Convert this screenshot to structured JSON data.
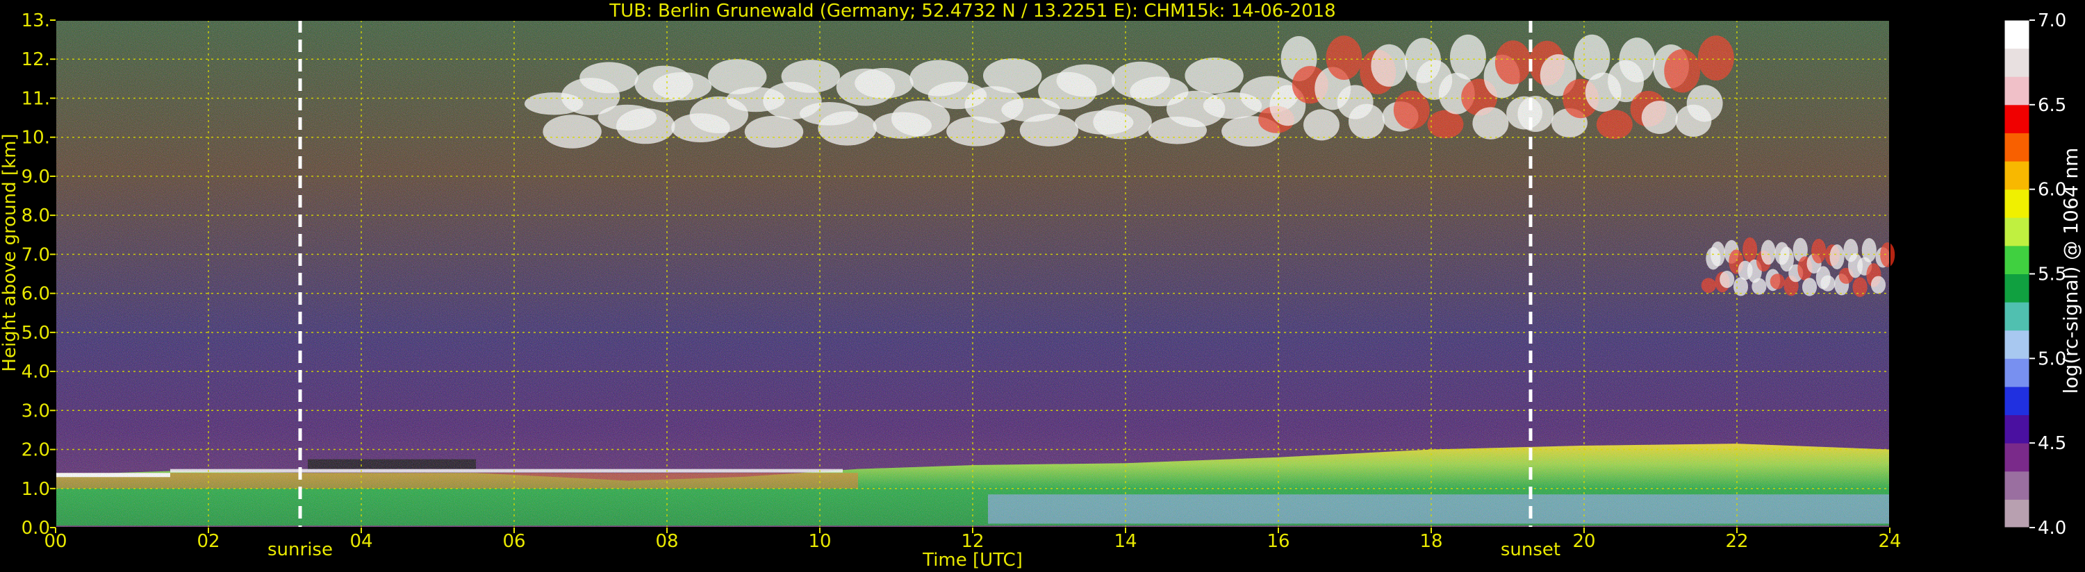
{
  "chart_data": {
    "type": "heatmap",
    "title": "TUB: Berlin Grunewald (Germany; 52.4732 N / 13.2251 E):    CHM15k: 14-06-2018",
    "xlabel": "Time [UTC]",
    "ylabel": "Height above ground [km]",
    "xlim": [
      0,
      24
    ],
    "ylim": [
      0,
      13
    ],
    "x_ticks": [
      "00",
      "02",
      "04",
      "06",
      "08",
      "10",
      "12",
      "14",
      "16",
      "18",
      "20",
      "22",
      "24"
    ],
    "y_ticks": [
      "0.0",
      "1.0",
      "2.0",
      "3.0",
      "4.0",
      "5.0",
      "6.0",
      "7.0",
      "8.0",
      "9.0",
      "10.",
      "11.",
      "12.",
      "13."
    ],
    "grid": true,
    "colorbar": {
      "label": "log(rc-signal) @ 1064 nm",
      "range": [
        4.0,
        7.0
      ],
      "ticks": [
        "4.0",
        "4.5",
        "5.0",
        "5.5",
        "6.0",
        "6.5",
        "7.0"
      ]
    },
    "markers": [
      {
        "label": "sunrise",
        "time": 3.2
      },
      {
        "label": "sunset",
        "time": 19.3
      }
    ],
    "features": {
      "boundary_layer_top_km": [
        {
          "t": 0,
          "h": 1.35
        },
        {
          "t": 1.5,
          "h": 1.45
        },
        {
          "t": 3.2,
          "h": 1.4
        },
        {
          "t": 5.5,
          "h": 1.4
        },
        {
          "t": 6.5,
          "h": 1.3
        },
        {
          "t": 7.5,
          "h": 1.2
        },
        {
          "t": 9,
          "h": 1.3
        },
        {
          "t": 10.5,
          "h": 1.5
        },
        {
          "t": 12,
          "h": 1.6
        },
        {
          "t": 14,
          "h": 1.65
        },
        {
          "t": 16,
          "h": 1.8
        },
        {
          "t": 18,
          "h": 2.0
        },
        {
          "t": 20,
          "h": 2.1
        },
        {
          "t": 22,
          "h": 2.15
        },
        {
          "t": 24,
          "h": 2.0
        }
      ],
      "cirrus_clouds": [
        {
          "t_start": 6.4,
          "t_end": 16.0,
          "h_low": 9.3,
          "h_high": 11.7
        },
        {
          "t_start": 15.9,
          "t_end": 21.8,
          "h_low": 9.3,
          "h_high": 12.2
        },
        {
          "t_start": 21.6,
          "t_end": 24.0,
          "h_low": 5.6,
          "h_high": 7.2
        }
      ]
    }
  },
  "colors": {
    "axis_text": "#e8e800",
    "grid": "#d8d800",
    "marker": "#ffffff",
    "background": "#000000",
    "colorbar_stops": [
      "#b8a0b0",
      "#9a6fa0",
      "#7a2a8a",
      "#4a10a0",
      "#2030e0",
      "#7890f0",
      "#a8c8f0",
      "#50c0b0",
      "#10a040",
      "#40d040",
      "#c0f040",
      "#f0f000",
      "#f8b800",
      "#f86000",
      "#f00000",
      "#f0c0c8",
      "#e8e0e0",
      "#ffffff"
    ]
  }
}
